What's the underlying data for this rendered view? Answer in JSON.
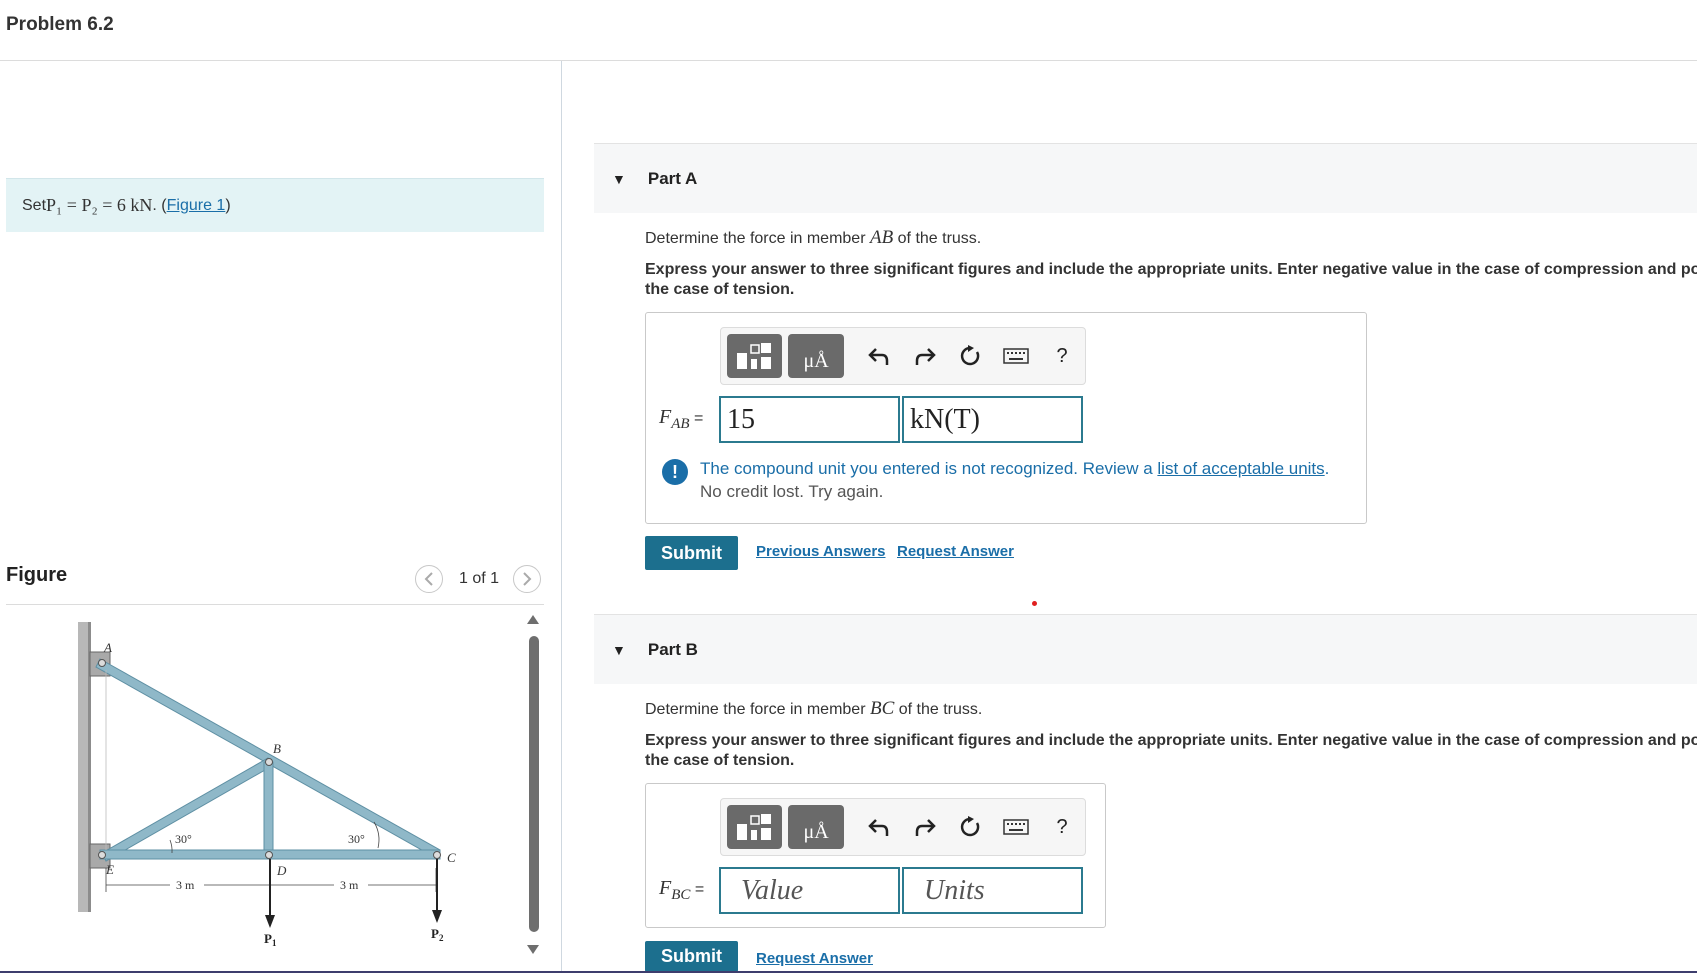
{
  "page": {
    "title": "Problem 6.2"
  },
  "problem": {
    "set_prefix": "Set ",
    "set_math": "P₁ = P₂ = 6 kN",
    "set_after": ". (",
    "figure_link": "Figure 1",
    "set_close": ")"
  },
  "figure": {
    "heading": "Figure",
    "pager": "1 of 1",
    "prev_icon": "chevron-left-icon",
    "next_icon": "chevron-right-icon",
    "labels": {
      "A": "A",
      "B": "B",
      "C": "C",
      "D": "D",
      "E": "E",
      "angle1": "30°",
      "angle2": "30°",
      "dim1": "3 m",
      "dim2": "3 m",
      "p1": "P",
      "p1_sub": "1",
      "p2": "P",
      "p2_sub": "2"
    }
  },
  "partA": {
    "label": "Part A",
    "q_prefix": "Determine the force in member ",
    "q_member": "AB",
    "q_suffix": " of the truss.",
    "instr_line1": "Express your answer to three significant figures and include the appropriate units. Enter negative value in the case of compression and positive value in",
    "instr_line2": "the case of tension.",
    "var_main": "F",
    "var_sub": "AB",
    "equals": " =",
    "value": "15",
    "units": "kN(T)",
    "error_text": "The compound unit you entered is not recognized. Review a ",
    "error_link": "list of acceptable units",
    "error_end": ".",
    "error_sub": "No credit lost. Try again.",
    "submit": "Submit",
    "previous_answers": "Previous Answers",
    "request_answer": "Request Answer"
  },
  "partB": {
    "label": "Part B",
    "q_prefix": "Determine the force in member ",
    "q_member": "BC",
    "q_suffix": " of the truss.",
    "instr_line1": "Express your answer to three significant figures and include the appropriate units. Enter negative value in the case of compression and positive value in",
    "instr_line2": "the case of tension.",
    "var_main": "F",
    "var_sub": "BC",
    "equals": " =",
    "value_placeholder": "Value",
    "units_placeholder": "Units",
    "submit": "Submit",
    "request_answer": "Request Answer"
  },
  "toolbar": {
    "units_glyph": "μÅ",
    "help": "?",
    "icons": [
      "templates-icon",
      "units-icon",
      "undo-icon",
      "redo-icon",
      "reset-icon",
      "keyboard-icon",
      "help-icon"
    ]
  },
  "colors": {
    "accent": "#1c6f8e",
    "link": "#1a6ea8",
    "truss": "#8fb8c8",
    "info_bg": "#e3f3f5",
    "error_dot": "#e02020"
  }
}
